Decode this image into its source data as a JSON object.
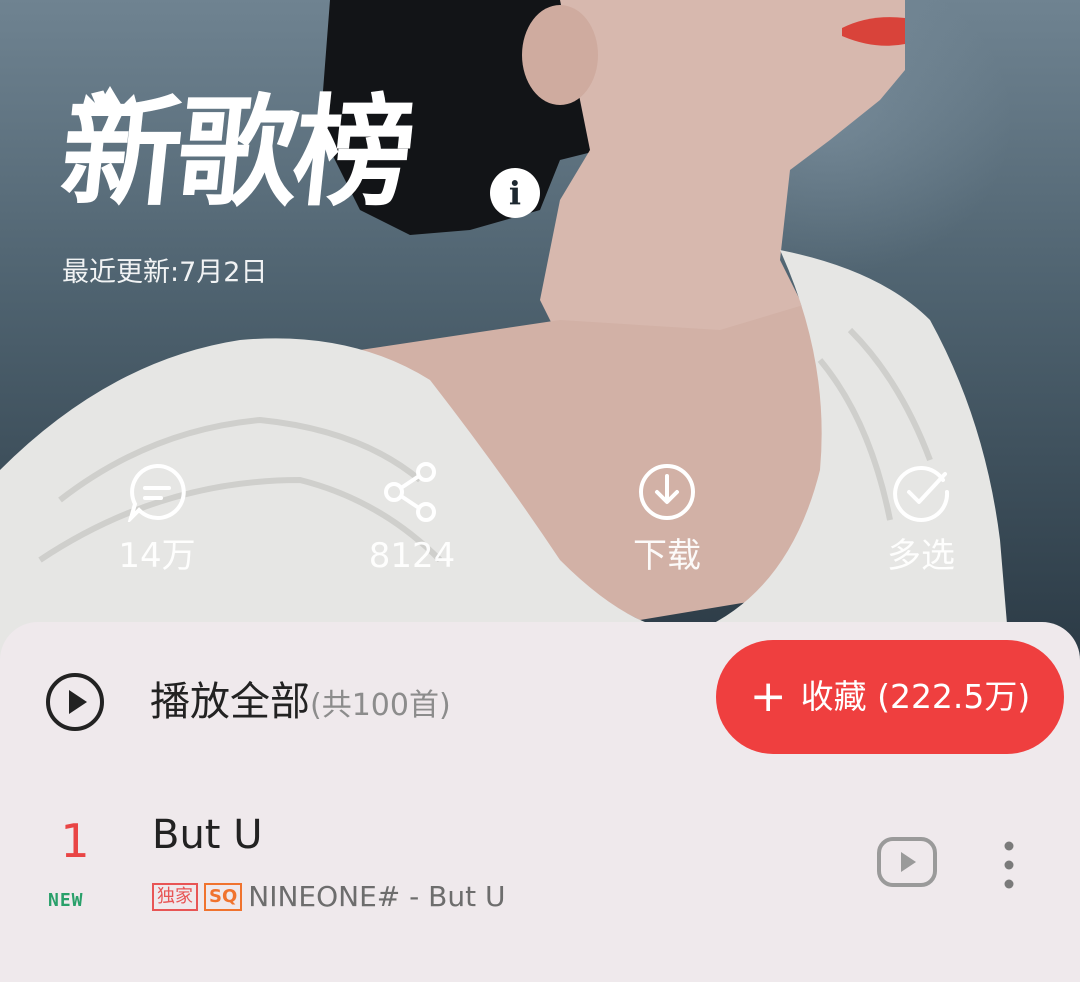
{
  "hero": {
    "title": "新歌榜",
    "updated": "最近更新:7月2日",
    "info_icon": "i",
    "actions": [
      {
        "icon": "comment-icon",
        "label": "14万"
      },
      {
        "icon": "share-icon",
        "label": "8124"
      },
      {
        "icon": "download-icon",
        "label": "下载"
      },
      {
        "icon": "multi-select-icon",
        "label": "多选"
      }
    ]
  },
  "list_header": {
    "play_all_label": "播放全部",
    "count": "(共100首)",
    "collect_plus": "+",
    "collect_label": "收藏 (222.5万)",
    "accent_color": "#ef3f3f"
  },
  "songs": [
    {
      "rank": "1",
      "badge": "NEW",
      "title": "But U",
      "tags": [
        "独家",
        "SQ"
      ],
      "subtitle": "NINEONE# - But U"
    }
  ]
}
